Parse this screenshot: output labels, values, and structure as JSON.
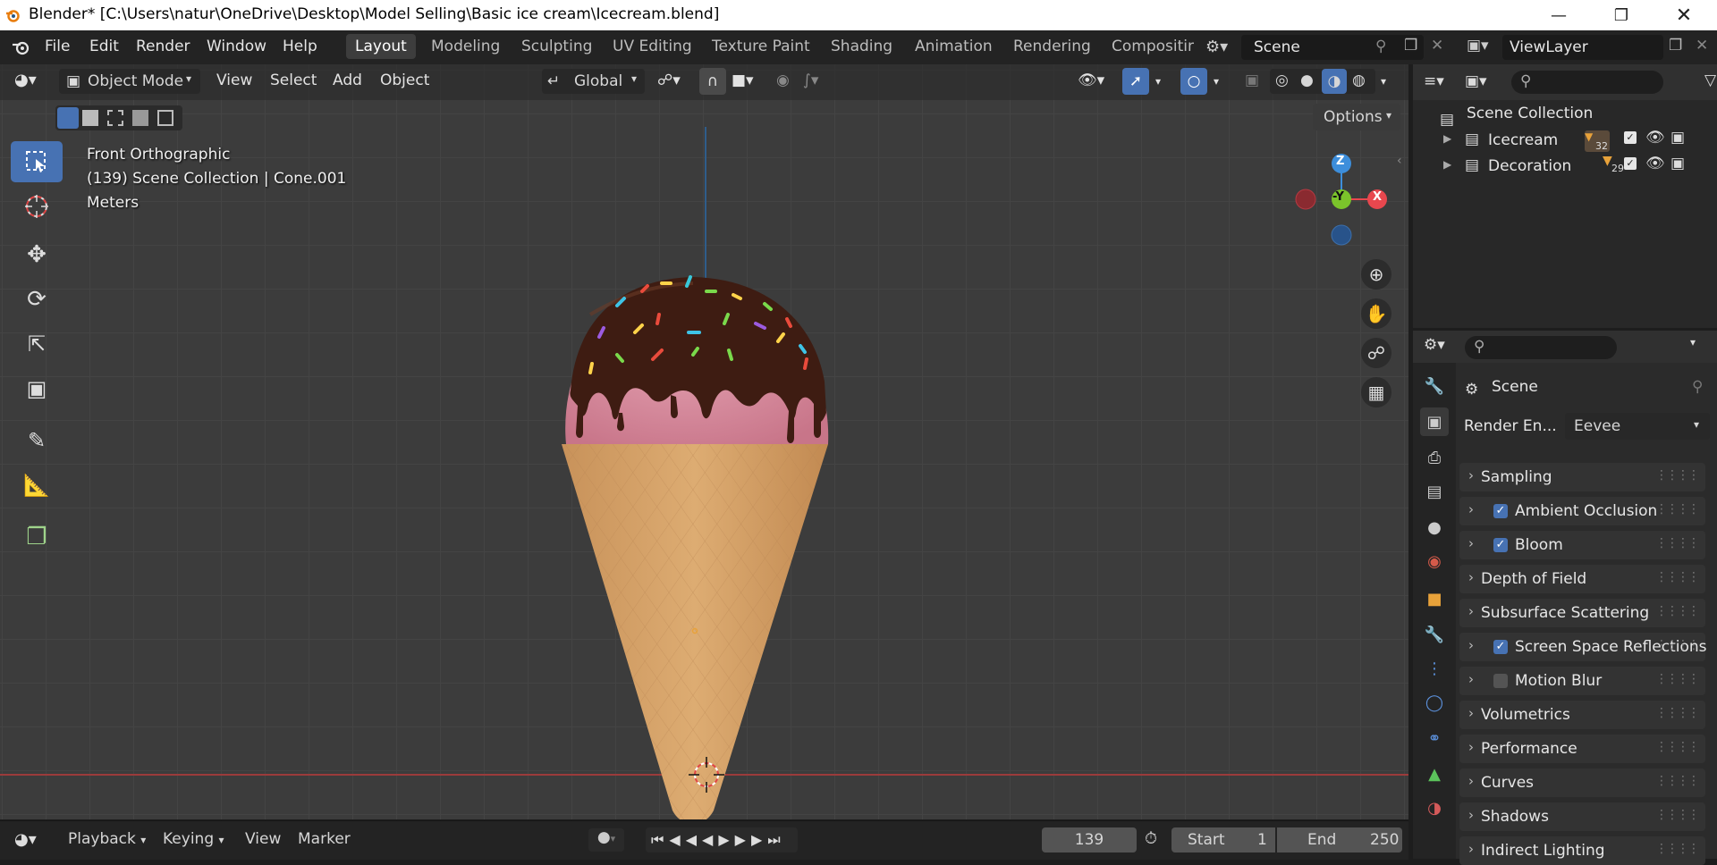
{
  "window": {
    "title": "Blender* [C:\\Users\\natur\\OneDrive\\Desktop\\Model Selling\\Basic ice cream\\Icecream.blend]",
    "minimize_icon": "minimize-icon",
    "restore_icon": "restore-icon",
    "close_icon": "close-icon"
  },
  "menu": {
    "items": [
      "File",
      "Edit",
      "Render",
      "Window",
      "Help"
    ]
  },
  "workspaces": {
    "tabs": [
      "Layout",
      "Modeling",
      "Sculpting",
      "UV Editing",
      "Texture Paint",
      "Shading",
      "Animation",
      "Rendering",
      "Compositin"
    ],
    "active": "Layout"
  },
  "scene_selector": {
    "value": "Scene"
  },
  "viewlayer_selector": {
    "value": "ViewLayer"
  },
  "viewport_header": {
    "mode": "Object Mode",
    "menus": [
      "View",
      "Select",
      "Add",
      "Object"
    ],
    "orientation": "Global",
    "options_label": "Options"
  },
  "viewport_overlay": {
    "view_name": "Front Orthographic",
    "collection_info": "(139) Scene Collection | Cone.001",
    "units": "Meters"
  },
  "gizmo": {
    "z": "Z",
    "y": "-Y",
    "x": "X"
  },
  "outliner": {
    "root": "Scene Collection",
    "items": [
      {
        "name": "Icecream",
        "count": "32"
      },
      {
        "name": "Decoration",
        "count": "29"
      }
    ]
  },
  "properties": {
    "context": "Scene",
    "render_engine_label": "Render En...",
    "render_engine_value": "Eevee",
    "panels": [
      {
        "label": "Sampling",
        "checkbox": null
      },
      {
        "label": "Ambient Occlusion",
        "checkbox": true
      },
      {
        "label": "Bloom",
        "checkbox": true
      },
      {
        "label": "Depth of Field",
        "checkbox": null
      },
      {
        "label": "Subsurface Scattering",
        "checkbox": null
      },
      {
        "label": "Screen Space Reflections",
        "checkbox": true
      },
      {
        "label": "Motion Blur",
        "checkbox": false
      },
      {
        "label": "Volumetrics",
        "checkbox": null
      },
      {
        "label": "Performance",
        "checkbox": null
      },
      {
        "label": "Curves",
        "checkbox": null
      },
      {
        "label": "Shadows",
        "checkbox": null
      },
      {
        "label": "Indirect Lighting",
        "checkbox": null
      }
    ]
  },
  "timeline": {
    "menus": [
      "Playback",
      "Keying",
      "View",
      "Marker"
    ],
    "current_frame": "139",
    "start_label": "Start",
    "start_value": "1",
    "end_label": "End",
    "end_value": "250"
  },
  "colors": {
    "accent_blue": "#4772b3",
    "axis_x": "#e8474e",
    "axis_y": "#7bc42b",
    "axis_z": "#3d8edb",
    "cone": "#d7a56a",
    "icecream": "#d68a9c",
    "chocolate": "#3b1a12"
  }
}
